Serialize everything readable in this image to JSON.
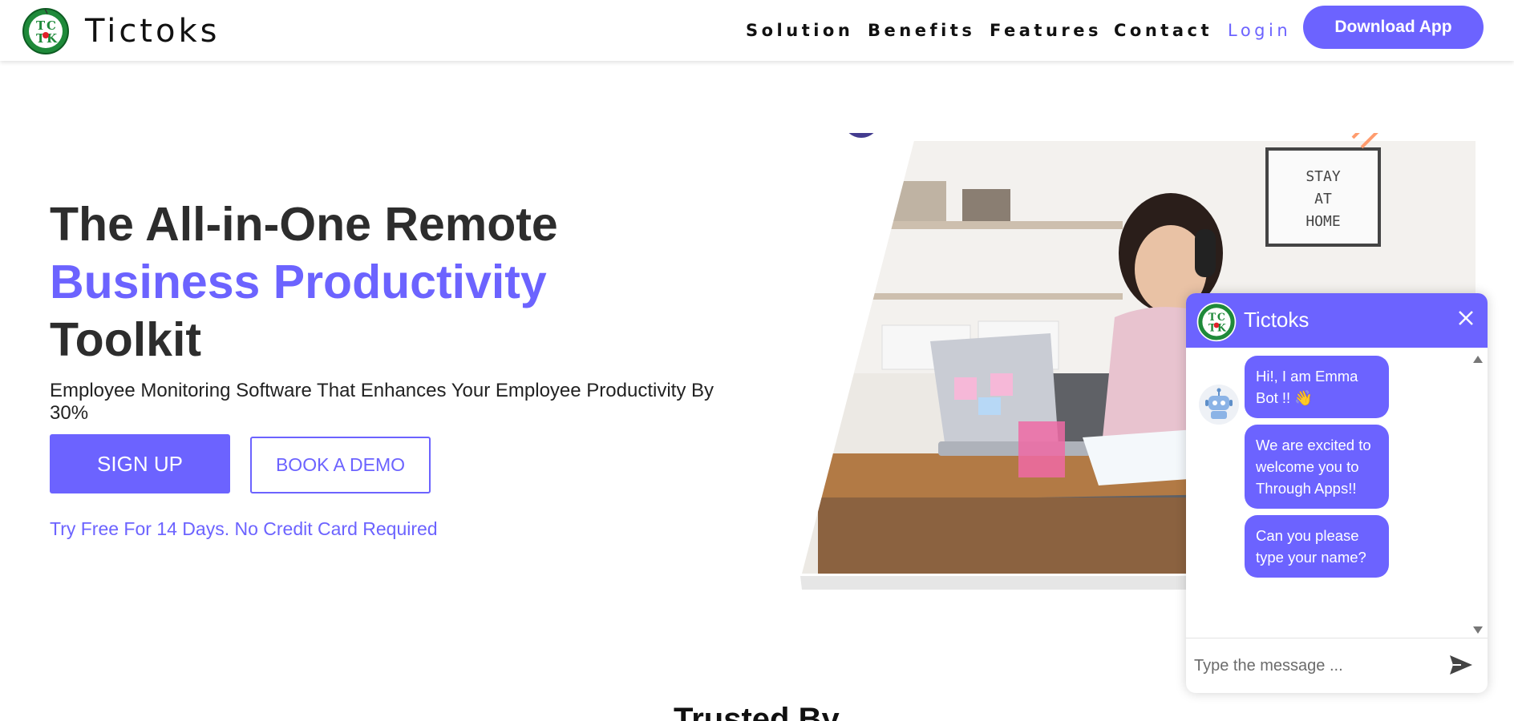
{
  "header": {
    "brand": "Tictoks",
    "nav": [
      {
        "label": "Solution"
      },
      {
        "label": "Benefits"
      },
      {
        "label": "Features"
      },
      {
        "label": "Contact"
      }
    ],
    "login": "Login",
    "download": "Download App"
  },
  "hero": {
    "line1": "The All-in-One Remote",
    "line2": "Business Productivity",
    "line3": "Toolkit",
    "subtitle": "Employee Monitoring Software That Enhances Your Employee Productivity By 30%",
    "signup": "SIGN UP",
    "demo": "BOOK A DEMO",
    "trial": "Try Free For 14 Days. No Credit Card Required",
    "image_sign": [
      "STAY",
      "AT",
      "HOME"
    ]
  },
  "trusted": "Trusted By",
  "chat": {
    "title": "Tictoks",
    "messages": [
      "Hi!, I am Emma Bot !! 👋",
      "We are excited to welcome you to Through Apps!!",
      "Can you please type your name?"
    ],
    "input_placeholder": "Type the message ..."
  },
  "colors": {
    "accent": "#6c63ff",
    "decor_circle": "#433c8f",
    "decor_orange": "#ff8a66"
  },
  "icons": {
    "logo": "tictoks-logo-icon",
    "close": "close-icon",
    "send": "send-icon",
    "bot": "robot-icon"
  }
}
